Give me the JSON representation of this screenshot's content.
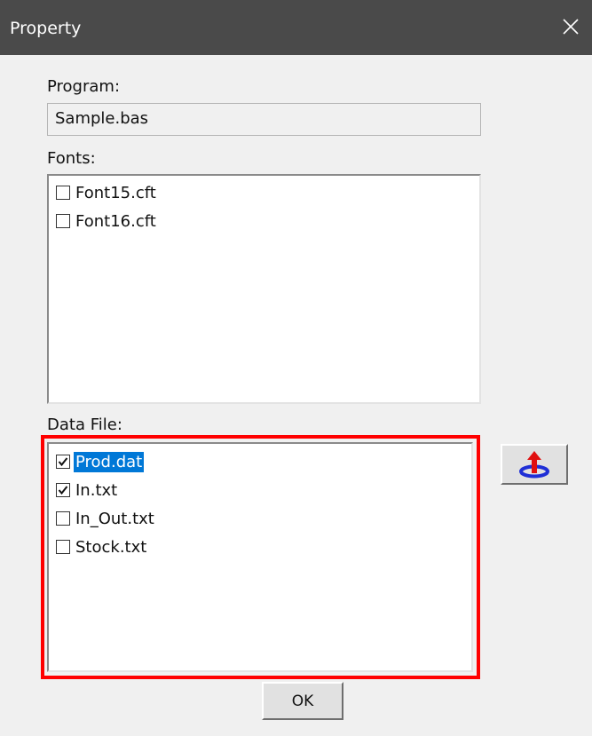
{
  "window": {
    "title": "Property",
    "close_icon": "close-icon",
    "titlebar_color": "#4a4a4a"
  },
  "program": {
    "label": "Program:",
    "value": "Sample.bas"
  },
  "fonts": {
    "label": "Fonts:",
    "items": [
      {
        "label": "Font15.cft",
        "checked": false
      },
      {
        "label": "Font16.cft",
        "checked": false
      }
    ]
  },
  "data_file": {
    "label": "Data File:",
    "items": [
      {
        "label": "Prod.dat",
        "checked": true,
        "selected": true
      },
      {
        "label": "In.txt",
        "checked": true,
        "selected": false
      },
      {
        "label": "In_Out.txt",
        "checked": false,
        "selected": false
      },
      {
        "label": "Stock.txt",
        "checked": false,
        "selected": false
      }
    ],
    "highlight_color": "#ff0000",
    "selection_color": "#0078d7"
  },
  "upload_button": {
    "icon": "upload-icon"
  },
  "ok_button": {
    "label": "OK"
  }
}
